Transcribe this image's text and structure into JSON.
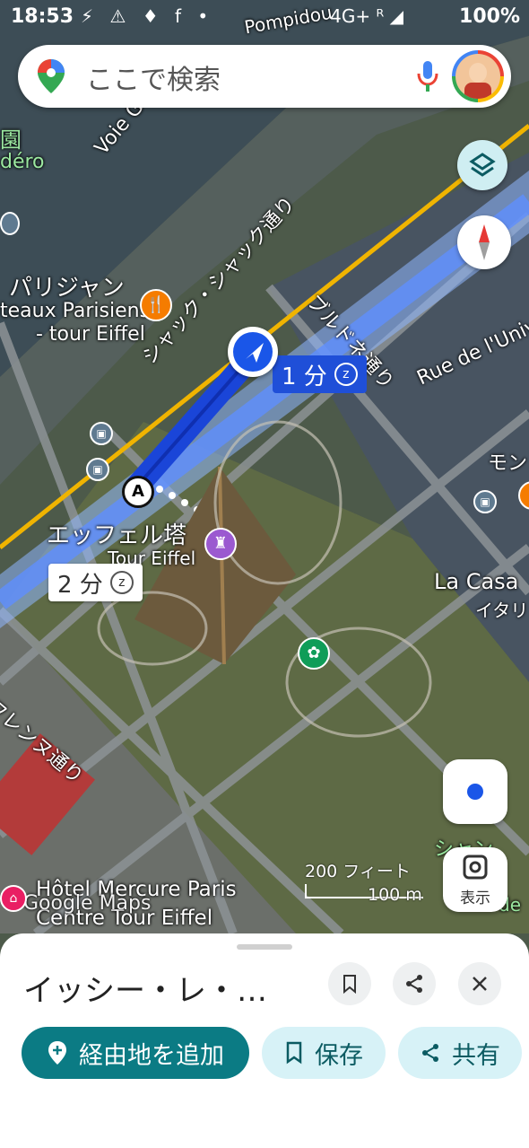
{
  "status_bar": {
    "time": "18:53",
    "icons": "⚡ ⚠ ♦ f •",
    "network": "4G+ ᴿ ◢",
    "battery": "100%"
  },
  "search": {
    "placeholder": "ここで検索"
  },
  "map": {
    "labels": {
      "paris_jean": "パリジャン",
      "bateaux": "teaux Parisiens",
      "tour_eiffel_small": "- tour Eiffel",
      "voie": "Voie G",
      "pompidou": "Pompidou",
      "jardin": "園",
      "dero": "déro",
      "jacques": "シャック・シャック通り",
      "branly": "ブルドネ通り",
      "univ": "Rue de l'Univ",
      "mon": "モン",
      "eiffel_jp": "エッフェル塔",
      "eiffel_fr": "Tour Eiffel",
      "casa": "La Casa",
      "italy": "イタリ",
      "suffren": "フレンヌ通り",
      "hotel_line1": "Hôtel Mercure Paris",
      "hotel_line2": "Centre Tour Eiffel",
      "google_maps": "Google Maps",
      "shan": "シャン",
      "de": "de"
    },
    "route_chip_1": {
      "text": "1 分"
    },
    "route_chip_2": {
      "text": "2 分"
    },
    "waypoint": "A",
    "scale": {
      "feet": "200 フィート",
      "meters": "100 m"
    },
    "view_button": "表示"
  },
  "sheet": {
    "destination": "イッシー・レ・…",
    "add_stop": "経由地を追加",
    "save": "保存",
    "share": "共有"
  },
  "colors": {
    "route_blue": "#1a56e8",
    "accent_teal": "#0b7b84",
    "chip_blue": "#1f4fd8"
  }
}
